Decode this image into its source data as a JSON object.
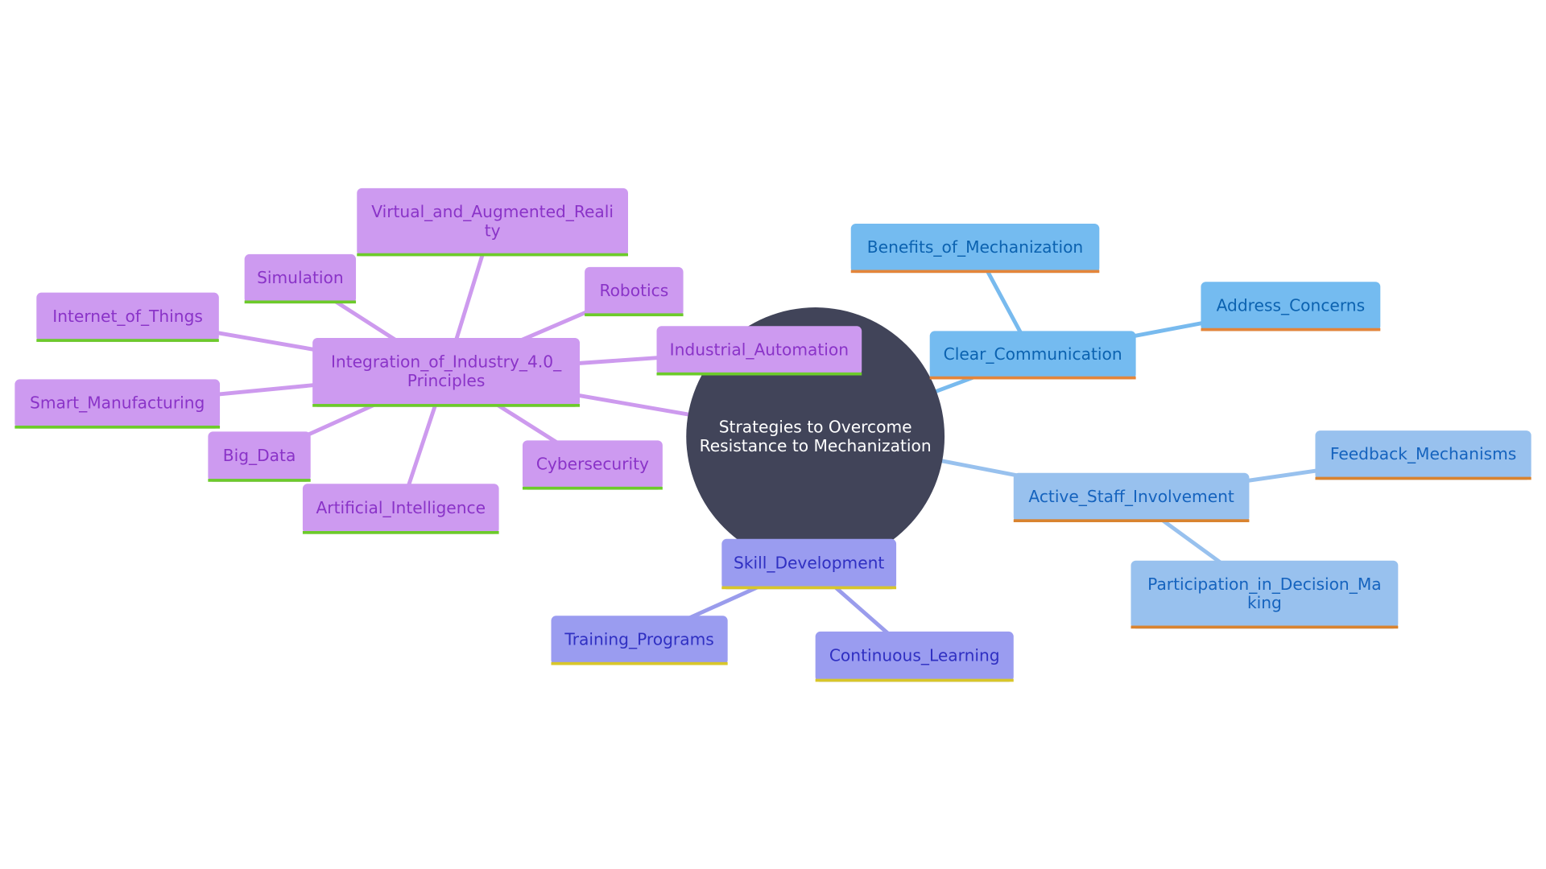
{
  "root": {
    "lines": [
      "Strategies to Overcome",
      "Resistance to Mechanization"
    ],
    "fill": "#414459",
    "text_color": "#ffffff"
  },
  "branches": [
    {
      "id": "clear",
      "lines": [
        "Clear_Communication"
      ],
      "fill": "#74bbf0",
      "text_color": "#0b62b0",
      "underline": "#e4853a",
      "edge": "#78baee",
      "children": [
        {
          "id": "benefits",
          "lines": [
            "Benefits_of_Mechanization"
          ]
        },
        {
          "id": "address",
          "lines": [
            "Address_Concerns"
          ]
        }
      ]
    },
    {
      "id": "active",
      "lines": [
        "Active_Staff_Involvement"
      ],
      "fill": "#98c1ee",
      "text_color": "#1563be",
      "underline": "#d9832f",
      "edge": "#98c1ee",
      "children": [
        {
          "id": "feedback",
          "lines": [
            "Feedback_Mechanisms"
          ]
        },
        {
          "id": "participation",
          "lines": [
            "Participation_in_Decision_Ma",
            "king"
          ]
        }
      ]
    },
    {
      "id": "skill",
      "lines": [
        "Skill_Development"
      ],
      "fill": "#9a9cf0",
      "text_color": "#2f2fc2",
      "underline": "#d8c62a",
      "edge": "#9a9cec",
      "children": [
        {
          "id": "training",
          "lines": [
            "Training_Programs"
          ]
        },
        {
          "id": "continuous",
          "lines": [
            "Continuous_Learning"
          ]
        }
      ]
    },
    {
      "id": "integration",
      "lines": [
        "Integration_of_Industry_4.0_",
        "Principles"
      ],
      "fill": "#cd9af0",
      "text_color": "#8a33c8",
      "underline": "#6ccb2a",
      "edge": "#cd9aee",
      "children": [
        {
          "id": "virtual",
          "lines": [
            "Virtual_and_Augmented_Reali",
            "ty"
          ]
        },
        {
          "id": "simulation",
          "lines": [
            "Simulation"
          ]
        },
        {
          "id": "robotics",
          "lines": [
            "Robotics"
          ]
        },
        {
          "id": "iot",
          "lines": [
            "Internet_of_Things"
          ]
        },
        {
          "id": "industrial",
          "lines": [
            "Industrial_Automation"
          ]
        },
        {
          "id": "smart",
          "lines": [
            "Smart_Manufacturing"
          ]
        },
        {
          "id": "bigdata",
          "lines": [
            "Big_Data"
          ]
        },
        {
          "id": "cyber",
          "lines": [
            "Cybersecurity"
          ]
        },
        {
          "id": "ai",
          "lines": [
            "Artificial_Intelligence"
          ]
        }
      ]
    }
  ]
}
